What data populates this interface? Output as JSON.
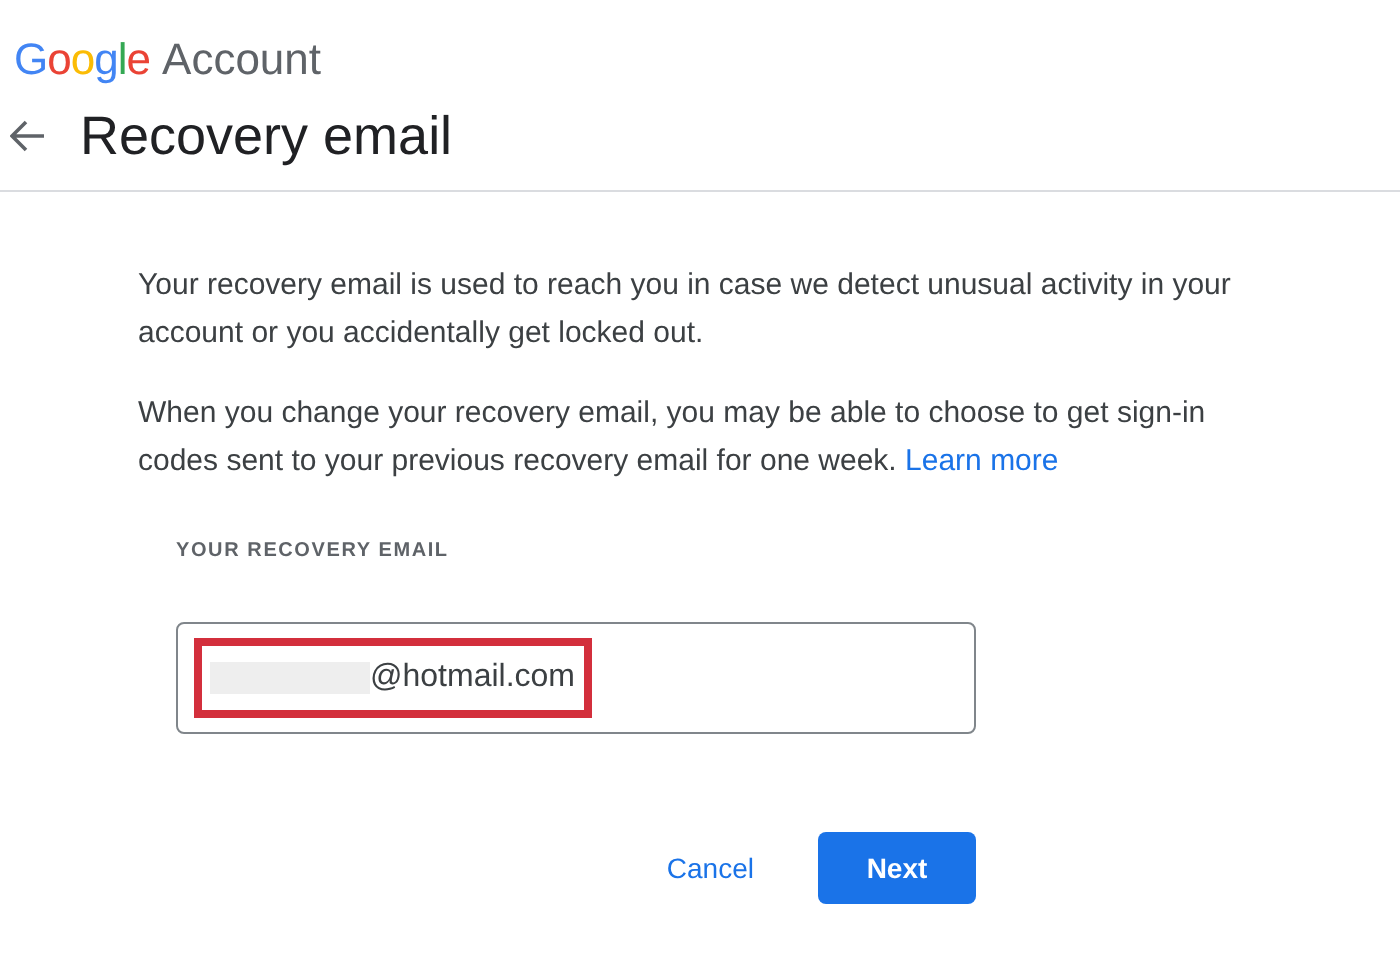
{
  "header": {
    "logo": "Google",
    "product": "Account"
  },
  "page": {
    "title": "Recovery email"
  },
  "paragraphs": [
    {
      "text": "Your recovery email is used to reach you in case we detect unusual activity in your account or you accidentally get locked out."
    },
    {
      "text": "When you change your recovery email, you may be able to choose to get sign-in codes sent to your previous recovery email for one week.",
      "link": "Learn more"
    }
  ],
  "field": {
    "label": "YOUR RECOVERY EMAIL",
    "value": "@hotmail.com",
    "redacted": true,
    "highlighted": true
  },
  "buttons": [
    {
      "kind": "text",
      "label": "Cancel"
    },
    {
      "kind": "primary",
      "label": "Next"
    }
  ]
}
